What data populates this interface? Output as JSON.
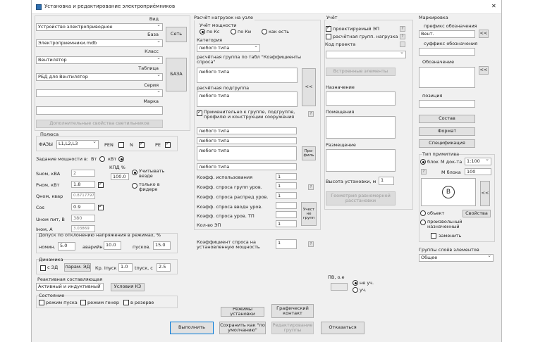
{
  "window": {
    "title": "Установка и редактирование электроприёмников",
    "close": "✕"
  },
  "device": {
    "vid_label": "Вид",
    "vid_value": "Устройство электроприводное",
    "baza_label": "База",
    "baza_value": "Электроприемники.mdb",
    "set_btn": "Сеть",
    "klass_label": "Класс",
    "klass_value": "Вентилятор",
    "table_label": "Таблица",
    "table_value": "РБД для Вентилятор",
    "baza_btn": "БАЗА",
    "seria_label": "Серия",
    "seria_value": "",
    "marka_label": "Марка",
    "marka_value": "",
    "extra_props_btn": "Дополнительные свойства светильников"
  },
  "poles": {
    "label": "Полюса",
    "phases_label": "ФАЗЫ",
    "phases_value": "L1,L2,L3",
    "pen_label": "PEN",
    "n_label": "N",
    "pe_label": "PE"
  },
  "power": {
    "mode_label": "Задание мощности в:",
    "vt_label": "Вт",
    "kvt_label": "кВт",
    "kpd_label": "КПД %",
    "kpd_value": "100.0",
    "snom_label": "Sном, кВА",
    "snom_value": "2",
    "pnom_label": "Pном, кВт",
    "pnom_value": "1.8",
    "qnom_label": "Qном, квар",
    "qnom_value": "0.8717797",
    "cos_label": "Cos",
    "cos_value": "0.9",
    "usch_label": "Учитывать везде",
    "only_feeder_label": "только в фидере",
    "unom_label": "Uном пит, В",
    "unom_value": "380",
    "inom_label": "Iном, А",
    "inom_value": "3.03869"
  },
  "deviation": {
    "title": "Допуск по отклонению напряжения в режимах, %",
    "nom_label": "номин.",
    "nom_value": "5.0",
    "avar_label": "аварийн.",
    "avar_value": "10.0",
    "pusk_label": "пусков.",
    "pusk_value": "15.0"
  },
  "dynamics": {
    "title": "Динамика",
    "ed_label": "с ЭД",
    "param_btn": "парам. ЭД",
    "kr_label": "Кр. Iпуск",
    "kr_value": "1.0",
    "tpusk_label": "tпуск, с",
    "tpusk_value": "2.5"
  },
  "reactive": {
    "title": "Реактивная составляющая",
    "value": "Активный и индуктивный",
    "kz_btn": "Условия КЗ"
  },
  "state": {
    "title": "Состояние",
    "pusk": "режим пуска",
    "gen": "режим генер",
    "rezerv": "в резерве"
  },
  "calc": {
    "title": "Расчёт нагрузок на узле",
    "mode_title": "Учёт мощности",
    "kc": "по Кс",
    "ki": "по Ки",
    "asis": "как есть",
    "cat_label": "Категория",
    "cat_value": "любого типа",
    "group_label": "расчётная группа  по табл \"Коэффициенты спроса\"",
    "group_value": "любого типа",
    "subgroup_label": "расчётная подгруппа",
    "subgroup_value": "любого типа",
    "arrow_btn": "<<",
    "apply_label": "Применительно к группе, подгруппе, профилю и конструкции сооружения",
    "f1": "любого типа",
    "f2": "любого типа",
    "f3": "любого типа",
    "f4": "любого типа",
    "profile_btn": "Про-филь",
    "k_use_label": "Коэфф. использования",
    "k_use_value": "1",
    "k_group_label": "Коэфф. спроса групп уров.",
    "k_group_value": "1",
    "k_distr_label": "Коэфф. спроса распред уров.",
    "k_distr_value": "1",
    "k_input_label": "Коэфф. спроса вводн уров.",
    "k_input_value": "",
    "k_tp_label": "Коэфф. спроса уров. ТП",
    "k_tp_value": "",
    "count_label": "Кол-во ЭП",
    "count_value": "1",
    "count_groups_btn": "Учест не групп",
    "k_set_label": "Коэффициент спроса на установленную мощность",
    "k_set_value": "1"
  },
  "account": {
    "title": "Учёт",
    "projected": "проектируемый ЭП",
    "calc_group": "расчётная групп. нагрузка",
    "code_label": "Код проекта",
    "code_value": "",
    "embedded_btn": "Встроенные элементы",
    "purpose_label": "Назначение",
    "rooms_label": "Помещения",
    "placement_label": "Размещение",
    "height_label": "Высота установки, м",
    "height_value": "1",
    "geometry_btn": "Геометрия равномерной расстановки"
  },
  "marking": {
    "title": "Маркировка",
    "prefix_label": "префикс обозначения",
    "prefix_value": "Вент.",
    "suffix_label": "суффикс обозначения",
    "suffix_value": "",
    "designation_label": "Обозначение",
    "position_label": "позиция",
    "position_value": "",
    "sostav_btn": "Состав",
    "format_btn": "Формат",
    "spec_btn": "Спецификация",
    "prim_title": "Тип примитива",
    "block_label": "блок",
    "mdoc_label": "М док-та",
    "mdoc_value": "1:100",
    "mblock_label": "М блока",
    "mblock_value": "100",
    "obj_label": "объект",
    "props_btn": "Свойства",
    "custom_label": "произвольный назначенный",
    "replace_label": "заменить",
    "layers_label": "Группы слоёв элементов",
    "layers_value": "Общее",
    "symbol": "B"
  },
  "pv": {
    "label": "ПВ, о.е",
    "no_label": "не уч.",
    "yes_label": "уч."
  },
  "footer": {
    "modes": "Режимы установки",
    "graph": "Графический контакт",
    "run": "Выполнить",
    "save_default": "Сохранить как \"по умолчанию\"",
    "edit_groups": "Редактирование группы",
    "cancel": "Отказаться"
  }
}
